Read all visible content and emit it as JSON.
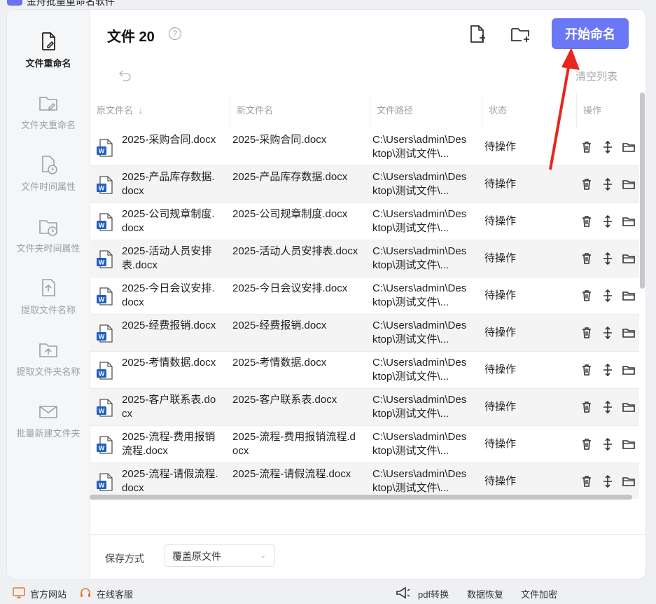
{
  "app": {
    "title": "金舟批量重命名软件"
  },
  "sidebar": {
    "items": [
      {
        "label": "文件重命名",
        "icon": "file-rename-icon",
        "active": true
      },
      {
        "label": "文件夹重命名",
        "icon": "folder-rename-icon",
        "active": false
      },
      {
        "label": "文件时间属性",
        "icon": "file-time-icon",
        "active": false
      },
      {
        "label": "文件夹时间属性",
        "icon": "folder-time-icon",
        "active": false
      },
      {
        "label": "提取文件名称",
        "icon": "extract-file-name-icon",
        "active": false
      },
      {
        "label": "提取文件夹名称",
        "icon": "extract-folder-name-icon",
        "active": false
      },
      {
        "label": "批量新建文件夹",
        "icon": "batch-new-folder-icon",
        "active": false
      }
    ]
  },
  "header": {
    "title": "文件 20",
    "help_icon": "?",
    "start_button": "开始命名",
    "clear_list": "清空列表"
  },
  "table": {
    "columns": [
      "原文件名",
      "新文件名",
      "文件路径",
      "状态",
      "操作"
    ],
    "rows": [
      {
        "original": "2025-采购合同.docx",
        "new": "2025-采购合同.docx",
        "path": "C:\\Users\\admin\\Desktop\\测试文件\\...",
        "status": "待操作"
      },
      {
        "original": "2025-产品库存数据.docx",
        "new": "2025-产品库存数据.docx",
        "path": "C:\\Users\\admin\\Desktop\\测试文件\\...",
        "status": "待操作"
      },
      {
        "original": "2025-公司规章制度.docx",
        "new": "2025-公司规章制度.docx",
        "path": "C:\\Users\\admin\\Desktop\\测试文件\\...",
        "status": "待操作"
      },
      {
        "original": "2025-活动人员安排表.docx",
        "new": "2025-活动人员安排表.docx",
        "path": "C:\\Users\\admin\\Desktop\\测试文件\\...",
        "status": "待操作"
      },
      {
        "original": "2025-今日会议安排.docx",
        "new": "2025-今日会议安排.docx",
        "path": "C:\\Users\\admin\\Desktop\\测试文件\\...",
        "status": "待操作"
      },
      {
        "original": "2025-经费报销.docx",
        "new": "2025-经费报销.docx",
        "path": "C:\\Users\\admin\\Desktop\\测试文件\\...",
        "status": "待操作"
      },
      {
        "original": "2025-考情数据.docx",
        "new": "2025-考情数据.docx",
        "path": "C:\\Users\\admin\\Desktop\\测试文件\\...",
        "status": "待操作"
      },
      {
        "original": "2025-客户联系表.docx",
        "new": "2025-客户联系表.docx",
        "path": "C:\\Users\\admin\\Desktop\\测试文件\\...",
        "status": "待操作"
      },
      {
        "original": "2025-流程-费用报销流程.docx",
        "new": "2025-流程-费用报销流程.docx",
        "path": "C:\\Users\\admin\\Desktop\\测试文件\\...",
        "status": "待操作"
      },
      {
        "original": "2025-流程-请假流程.docx",
        "new": "2025-流程-请假流程.docx",
        "path": "C:\\Users\\admin\\Desktop\\测试文件\\...",
        "status": "待操作"
      }
    ]
  },
  "bottom": {
    "save_label": "保存方式",
    "save_value": "覆盖原文件"
  },
  "footer": {
    "official_site": "官方网站",
    "online_service": "在线客服",
    "pdf_convert": "pdf转换",
    "data_recovery": "数据恢复",
    "file_encrypt": "文件加密"
  },
  "colors": {
    "accent": "#6a78f6",
    "word_blue": "#1f5fc2",
    "annotation_red": "#e8261c"
  }
}
